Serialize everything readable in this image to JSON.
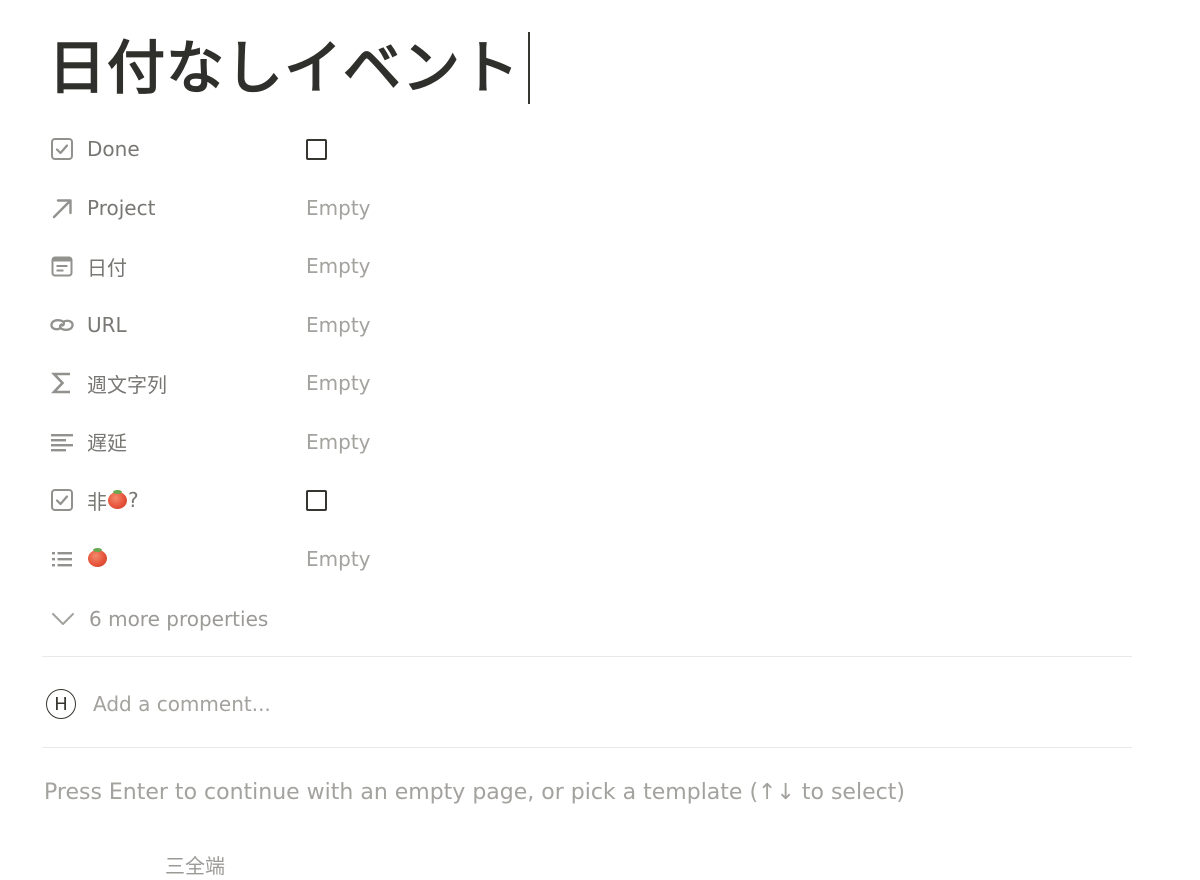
{
  "page": {
    "title": "日付なしイベント"
  },
  "properties": [
    {
      "icon": "checkbox-property-icon",
      "label": "Done",
      "value_type": "checkbox",
      "checked": false
    },
    {
      "icon": "relation-arrow-icon",
      "label": "Project",
      "value_type": "text",
      "value": "Empty"
    },
    {
      "icon": "calendar-icon",
      "label": "日付",
      "value_type": "text",
      "value": "Empty"
    },
    {
      "icon": "link-icon",
      "label": "URL",
      "value_type": "text",
      "value": "Empty"
    },
    {
      "icon": "sigma-formula-icon",
      "label": "週文字列",
      "value_type": "text",
      "value": "Empty"
    },
    {
      "icon": "text-lines-icon",
      "label": "遅延",
      "value_type": "text",
      "value": "Empty"
    },
    {
      "icon": "checkbox-property-icon",
      "label_prefix": "非",
      "label_suffix": "?",
      "label_emoji": "tomato-emoji",
      "value_type": "checkbox",
      "checked": false
    },
    {
      "icon": "list-icon",
      "label_emoji": "tomato-emoji",
      "value_type": "text",
      "value": "Empty"
    }
  ],
  "more_properties": {
    "label": "6 more properties",
    "icon": "chevron-down-icon"
  },
  "comment": {
    "avatar_letter": "H",
    "placeholder": "Add a comment..."
  },
  "hint": {
    "text": "Press Enter to continue with an empty page, or pick a template (↑↓ to select)"
  },
  "partial_bottom_text": "三全端",
  "colors": {
    "title": "#2f2f2b",
    "label": "#787774",
    "placeholder": "#a3a29e",
    "divider": "#e9e9e7"
  }
}
